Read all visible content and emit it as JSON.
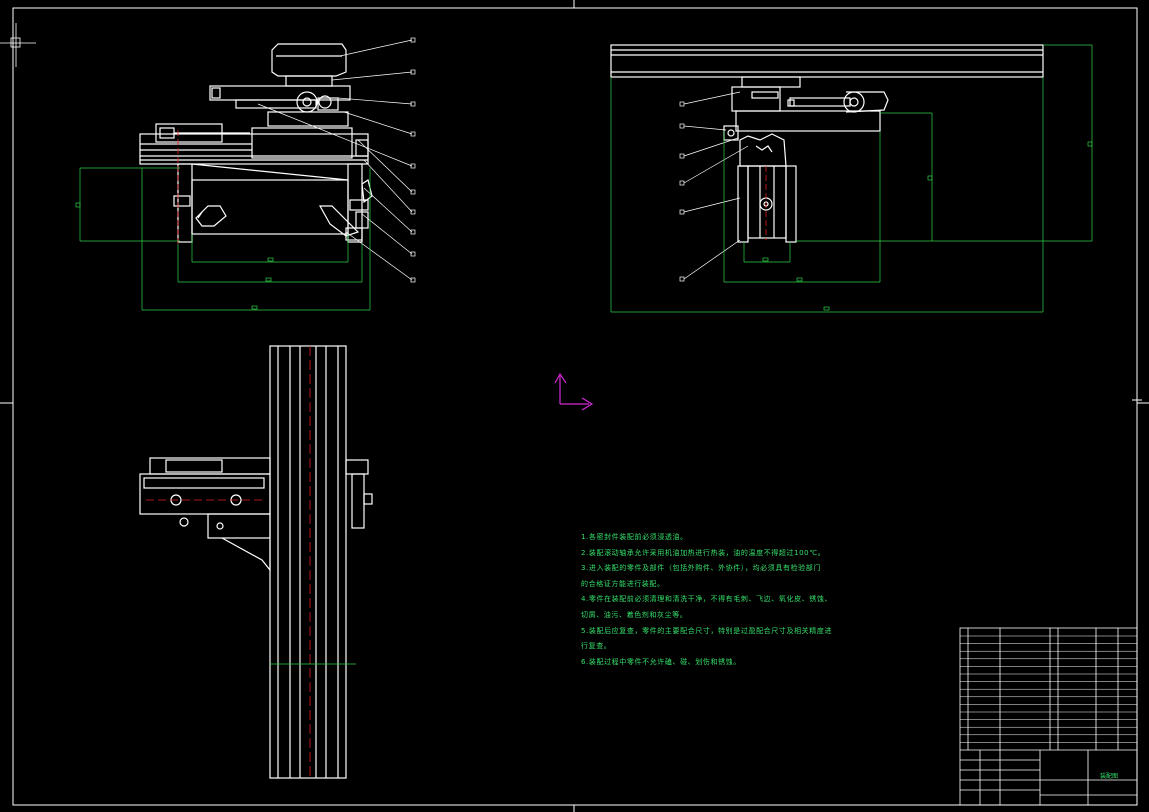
{
  "drawing": {
    "title_block_name": "装配图",
    "colors": {
      "background": "#000000",
      "geometry": "#ffffff",
      "dimension": "#2fd14a",
      "centerline": "#e02020",
      "ucs": "#d42bd4",
      "notes": "#36e06b"
    }
  },
  "technical_notes": [
    "1.各密封件装配前必须浸透油。",
    "2.装配滚动轴承允许采用机油加热进行热装，油的温度不得超过100℃。",
    "3.进入装配的零件及部件（包括外购件、外协件），均必须具有检验部门",
    "的合格证方能进行装配。",
    "4.零件在装配前必须清理和清洗干净，不得有毛刺、飞边、氧化皮、锈蚀、",
    "切屑、油污、着色剂和灰尘等。",
    "5.装配后应复查，零件的主要配合尺寸，特别是过盈配合尺寸及相关精度进",
    "行复查。",
    "6.装配过程中零件不允许磕、碰、划伤和锈蚀。"
  ]
}
